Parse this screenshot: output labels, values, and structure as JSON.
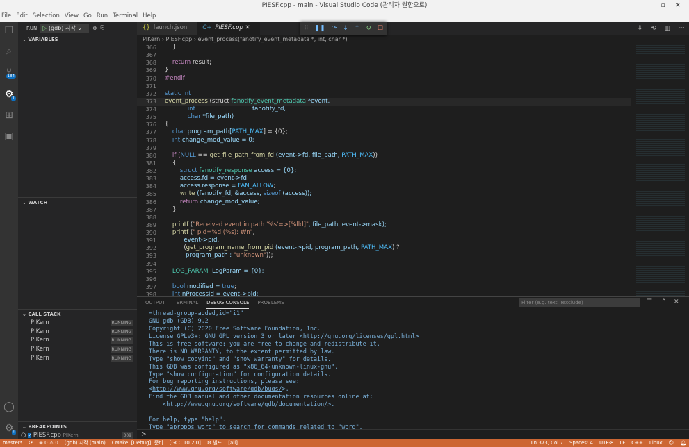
{
  "window": {
    "title": "PIESF.cpp - main - Visual Studio Code (관리자 권한으로)"
  },
  "menu": [
    "File",
    "Edit",
    "Selection",
    "View",
    "Go",
    "Run",
    "Terminal",
    "Help"
  ],
  "activity": {
    "scm_badge": "184",
    "debug_badge": "1",
    "settings_badge": "!"
  },
  "sidebar": {
    "run_label": "RUN",
    "config": "(gdb) 시작",
    "variables": "VARIABLES",
    "watch": "WATCH",
    "callstack": "CALL STACK",
    "threads": [
      {
        "name": "PIKern",
        "state": "RUNNING"
      },
      {
        "name": "PIKern",
        "state": "RUNNING"
      },
      {
        "name": "PIKern",
        "state": "RUNNING"
      },
      {
        "name": "PIKern",
        "state": "RUNNING"
      },
      {
        "name": "PIKern",
        "state": "RUNNING"
      }
    ],
    "breakpoints": "BREAKPOINTS",
    "bp": {
      "file": "PIESF.cpp",
      "folder": "PIKern",
      "line": "309"
    }
  },
  "tabs": [
    {
      "label": "launch.json",
      "icon": "{}"
    },
    {
      "label": "PIESF.cpp",
      "icon": "C+"
    }
  ],
  "breadcrumb": [
    "PIKern",
    "PIESF.cpp",
    "event_process(fanotify_event_metadata *, int, char *)"
  ],
  "code": [
    {
      "n": "366",
      "t": [
        [
          "    }",
          "p"
        ]
      ]
    },
    {
      "n": "367",
      "t": []
    },
    {
      "n": "368",
      "t": [
        [
          "    return ",
          "c"
        ],
        [
          "result;",
          "p"
        ]
      ]
    },
    {
      "n": "369",
      "t": [
        [
          "}",
          "p"
        ]
      ]
    },
    {
      "n": "370",
      "t": [
        [
          "#endif",
          "c"
        ]
      ]
    },
    {
      "n": "371",
      "t": []
    },
    {
      "n": "372",
      "t": [
        [
          "static int",
          "k"
        ]
      ]
    },
    {
      "n": "373",
      "t": [
        [
          "event_process",
          "f"
        ],
        [
          " (struct ",
          "p"
        ],
        [
          "fanotify_event_metadata",
          "t"
        ],
        [
          " *event,",
          "v"
        ]
      ]
    },
    {
      "n": "374",
      "t": [
        [
          "            int",
          "k"
        ],
        [
          "                              fanotify_fd,",
          "v"
        ]
      ]
    },
    {
      "n": "375",
      "t": [
        [
          "            char",
          "k"
        ],
        [
          " *file_path)",
          "v"
        ]
      ]
    },
    {
      "n": "376",
      "t": [
        [
          "{",
          "p"
        ]
      ]
    },
    {
      "n": "377",
      "t": [
        [
          "    char ",
          "k"
        ],
        [
          "program_path[",
          "v"
        ],
        [
          "PATH_MAX",
          "m"
        ],
        [
          "] = {0};",
          "p"
        ]
      ]
    },
    {
      "n": "378",
      "t": [
        [
          "    int ",
          "k"
        ],
        [
          "change_mod_value = 0;",
          "v"
        ]
      ]
    },
    {
      "n": "379",
      "t": []
    },
    {
      "n": "380",
      "t": [
        [
          "    if (",
          "c"
        ],
        [
          "NULL",
          "k"
        ],
        [
          " == ",
          "p"
        ],
        [
          "get_file_path_from_fd",
          "f"
        ],
        [
          " (event->fd, file_path, ",
          "v"
        ],
        [
          "PATH_MAX",
          "m"
        ],
        [
          "))",
          "p"
        ]
      ]
    },
    {
      "n": "381",
      "t": [
        [
          "    {",
          "p"
        ]
      ]
    },
    {
      "n": "382",
      "t": [
        [
          "        struct ",
          "k"
        ],
        [
          "fanotify_response",
          "t"
        ],
        [
          " access = {0};",
          "v"
        ]
      ]
    },
    {
      "n": "383",
      "t": [
        [
          "        access.fd = event->fd;",
          "v"
        ]
      ]
    },
    {
      "n": "384",
      "t": [
        [
          "        access.response = ",
          "v"
        ],
        [
          "FAN_ALLOW",
          "m"
        ],
        [
          ";",
          "p"
        ]
      ]
    },
    {
      "n": "385",
      "t": [
        [
          "        write",
          "f"
        ],
        [
          " (fanotify_fd, &access, ",
          "v"
        ],
        [
          "sizeof",
          "k"
        ],
        [
          " (access));",
          "v"
        ]
      ]
    },
    {
      "n": "386",
      "t": [
        [
          "        return ",
          "c"
        ],
        [
          "change_mod_value;",
          "v"
        ]
      ]
    },
    {
      "n": "387",
      "t": [
        [
          "    }",
          "p"
        ]
      ]
    },
    {
      "n": "388",
      "t": []
    },
    {
      "n": "389",
      "t": [
        [
          "    printf",
          "f"
        ],
        [
          " (",
          "p"
        ],
        [
          "\"Received event in path '%s'=>[%lld]\"",
          "s"
        ],
        [
          ", file_path, event->mask);",
          "v"
        ]
      ]
    },
    {
      "n": "390",
      "t": [
        [
          "    printf",
          "f"
        ],
        [
          " (",
          "p"
        ],
        [
          "\" pid=%d (%s): ₩n\"",
          "s"
        ],
        [
          ",",
          "p"
        ]
      ]
    },
    {
      "n": "391",
      "t": [
        [
          "          event->pid,",
          "v"
        ]
      ]
    },
    {
      "n": "392",
      "t": [
        [
          "          (",
          "p"
        ],
        [
          "get_program_name_from_pid",
          "f"
        ],
        [
          " (event->pid, program_path, ",
          "v"
        ],
        [
          "PATH_MAX",
          "m"
        ],
        [
          ") ?",
          "p"
        ]
      ]
    },
    {
      "n": "393",
      "t": [
        [
          "           program_path : ",
          "v"
        ],
        [
          "\"unknown\"",
          "s"
        ],
        [
          "));",
          "p"
        ]
      ]
    },
    {
      "n": "394",
      "t": []
    },
    {
      "n": "395",
      "t": [
        [
          "    LOG_PARAM",
          "t"
        ],
        [
          "  LogParam = {0};",
          "v"
        ]
      ]
    },
    {
      "n": "396",
      "t": []
    },
    {
      "n": "397",
      "t": [
        [
          "    bool ",
          "k"
        ],
        [
          "modified = ",
          "v"
        ],
        [
          "true",
          "k"
        ],
        [
          ";",
          "p"
        ]
      ]
    },
    {
      "n": "398",
      "t": [
        [
          "    int ",
          "k"
        ],
        [
          "nProcessId = event->pid;",
          "v"
        ]
      ]
    }
  ],
  "panel": {
    "tabs": [
      "OUTPUT",
      "TERMINAL",
      "DEBUG CONSOLE",
      "PROBLEMS"
    ],
    "active": "DEBUG CONSOLE",
    "filter_placeholder": "Filter (e.g. text, !exclude)",
    "console": [
      [
        [
          "=thread-group-added,id=\"i1\"",
          ""
        ]
      ],
      [
        [
          "GNU gdb (GDB) 9.2",
          ""
        ]
      ],
      [
        [
          "Copyright (C) 2020 Free Software Foundation, Inc.",
          ""
        ]
      ],
      [
        [
          "License GPLv3+: GNU GPL version 3 or later <",
          ""
        ],
        [
          "http://gnu.org/licenses/gpl.html",
          "a"
        ],
        [
          ">",
          ""
        ]
      ],
      [
        [
          "This is free software: you are free to change and redistribute it.",
          ""
        ]
      ],
      [
        [
          "There is NO WARRANTY, to the extent permitted by law.",
          ""
        ]
      ],
      [
        [
          "Type \"show copying\" and \"show warranty\" for details.",
          ""
        ]
      ],
      [
        [
          "This GDB was configured as \"x86_64-unknown-linux-gnu\".",
          ""
        ]
      ],
      [
        [
          "Type \"show configuration\" for configuration details.",
          ""
        ]
      ],
      [
        [
          "For bug reporting instructions, please see:",
          ""
        ]
      ],
      [
        [
          "<",
          ""
        ],
        [
          "http://www.gnu.org/software/gdb/bugs/",
          "a"
        ],
        [
          ">.",
          ""
        ]
      ],
      [
        [
          "Find the GDB manual and other documentation resources online at:",
          ""
        ]
      ],
      [
        [
          "    <",
          ""
        ],
        [
          "http://www.gnu.org/software/gdb/documentation/",
          "a"
        ],
        [
          ">.",
          ""
        ]
      ],
      [
        [
          "",
          ""
        ]
      ],
      [
        [
          "For help, type \"help\".",
          ""
        ]
      ],
      [
        [
          "Type \"apropos word\" to search for commands related to \"word\".",
          ""
        ]
      ]
    ],
    "prompt": ">"
  },
  "status": {
    "left": [
      "master*",
      "⟳",
      "⊗ 0 ⚠ 0",
      "(gdb) 시작 (main)",
      "CMake: [Debug]: 준비",
      "[GCC 10.2.0]",
      "⚙ 빌드",
      "[all]"
    ],
    "right": [
      "Ln 373, Col 7",
      "Spaces: 4",
      "UTF-8",
      "LF",
      "C++",
      "Linux"
    ]
  },
  "colors": {
    "status_bar": "#cc6633",
    "accent": "#0e70c0"
  }
}
